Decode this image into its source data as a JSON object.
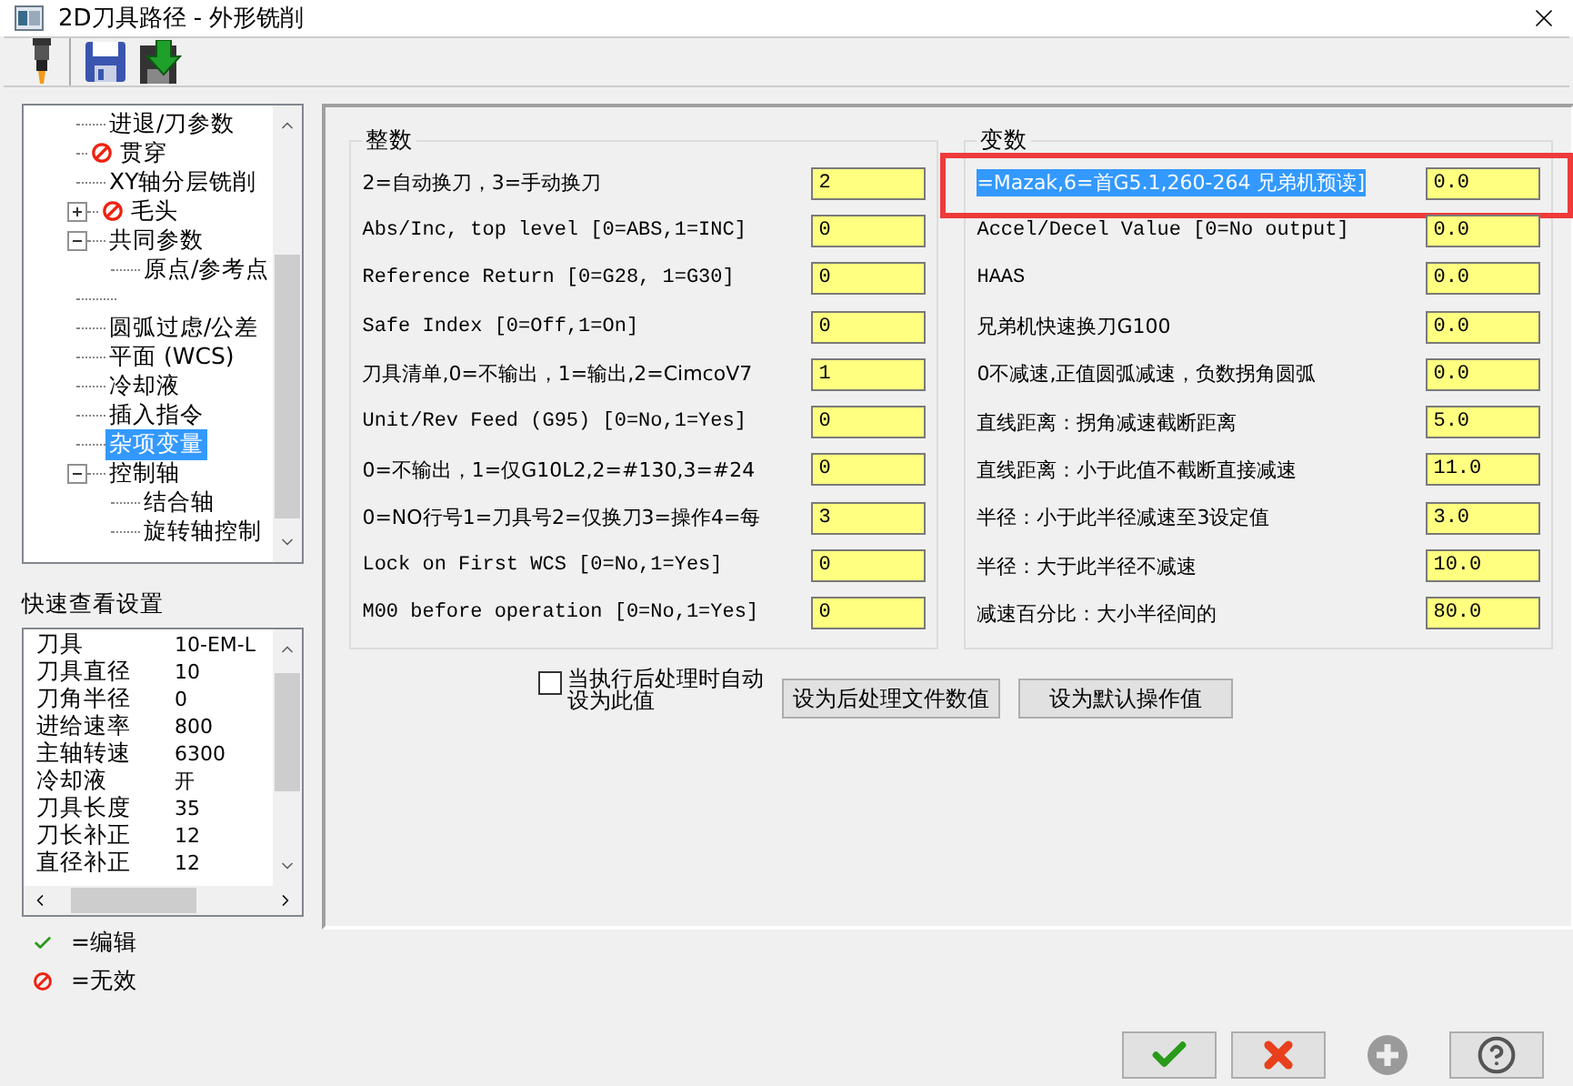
{
  "window": {
    "title": "2D刀具路径 - 外形铣削"
  },
  "tree": [
    {
      "children": [
        {
          "label": "进退/刀参数",
          "selected": false,
          "disabled": false
        },
        {
          "label": "贯穿",
          "selected": false,
          "disabled": true
        },
        {
          "label": "XY轴分层铣削",
          "selected": false,
          "disabled": false
        },
        {
          "label": "毛头",
          "selected": false,
          "disabled": true,
          "expanded": false
        }
      ]
    },
    {
      "label": "共同参数",
      "selected": false,
      "disabled": false,
      "expanded": true,
      "children": [
        {
          "label": "原点/参考点",
          "selected": false,
          "disabled": false
        }
      ]
    },
    {
      "kind": "blank"
    },
    {
      "label": "圆弧过虑/公差",
      "selected": false,
      "disabled": false
    },
    {
      "label": "平面 (WCS)",
      "selected": false,
      "disabled": false
    },
    {
      "label": "冷却液",
      "selected": false,
      "disabled": false
    },
    {
      "label": "插入指令",
      "selected": false,
      "disabled": false
    },
    {
      "label": "杂项变量",
      "selected": true,
      "disabled": false
    },
    {
      "label": "控制轴",
      "selected": false,
      "disabled": false,
      "expanded": true,
      "children": [
        {
          "label": "结合轴",
          "selected": false,
          "disabled": false
        },
        {
          "label": "旋转轴控制",
          "selected": false,
          "disabled": false
        }
      ]
    }
  ],
  "quick_view": {
    "title": "快速查看设置",
    "rows": [
      {
        "name": "刀具",
        "value": "10-EM-L"
      },
      {
        "name": "刀具直径",
        "value": "10"
      },
      {
        "name": "刀角半径",
        "value": "0"
      },
      {
        "name": "进给速率",
        "value": "800"
      },
      {
        "name": "主轴转速",
        "value": "6300"
      },
      {
        "name": "冷却液",
        "value": "开"
      },
      {
        "name": "刀具长度",
        "value": "35"
      },
      {
        "name": "刀长补正",
        "value": "12"
      },
      {
        "name": "直径补正",
        "value": "12"
      }
    ]
  },
  "legend": [
    {
      "kind": "edit",
      "text": "=编辑"
    },
    {
      "kind": "disabled",
      "text": "=无效"
    }
  ],
  "integers": {
    "title": "整数",
    "rows": [
      {
        "label": "2=自动换刀，3=手动换刀",
        "value": "2"
      },
      {
        "label": "Abs/Inc, top level [0=ABS,1=INC]",
        "value": "0"
      },
      {
        "label": "Reference Return [0=G28, 1=G30]",
        "value": "0"
      },
      {
        "label": "Safe Index [0=Off,1=On]",
        "value": "0"
      },
      {
        "label": "刀具清单,0=不输出，1=输出,2=CimcoV7",
        "value": "1"
      },
      {
        "label": "Unit/Rev Feed (G95) [0=No,1=Yes]",
        "value": "0"
      },
      {
        "label": "0=不输出，1=仅G10L2,2=#130,3=#24",
        "value": "0"
      },
      {
        "label": "0=NO行号1=刀具号2=仅换刀3=操作4=每",
        "value": "3"
      },
      {
        "label": "Lock on First WCS [0=No,1=Yes]",
        "value": "0"
      },
      {
        "label": "M00 before operation [0=No,1=Yes]",
        "value": "0"
      }
    ]
  },
  "variables": {
    "title": "变数",
    "rows": [
      {
        "label": "=Mazak,6=首G5.1,260-264 兄弟机预读]",
        "value": "0.0",
        "highlighted": true
      },
      {
        "label": "Accel/Decel Value [0=No output]",
        "value": "0.0",
        "highlighted": false
      },
      {
        "label": "HAAS",
        "value": "0.0",
        "highlighted": false
      },
      {
        "label": "兄弟机快速换刀G100",
        "value": "0.0",
        "highlighted": false
      },
      {
        "label": "0不减速,正值圆弧减速，负数拐角圆弧",
        "value": "0.0",
        "highlighted": false
      },
      {
        "label": "直线距离：拐角减速截断距离",
        "value": "5.0",
        "highlighted": false
      },
      {
        "label": "直线距离：小于此值不截断直接减速",
        "value": "11.0",
        "highlighted": false
      },
      {
        "label": "半径：小于此半径减速至3设定值",
        "value": "3.0",
        "highlighted": false
      },
      {
        "label": "半径：大于此半径不减速",
        "value": "10.0",
        "highlighted": false
      },
      {
        "label": "减速百分比：大小半径间的",
        "value": "80.0",
        "highlighted": false
      }
    ]
  },
  "auto_set": {
    "lines": [
      "当执行后处理时自动",
      "设为此值"
    ],
    "checked": false
  },
  "actions": [
    "设为后处理文件数值",
    "设为默认操作值"
  ],
  "dialog_buttons": [
    {
      "kind": "ok",
      "disabled": false
    },
    {
      "kind": "cancel",
      "disabled": false
    },
    {
      "kind": "add",
      "disabled": true
    },
    {
      "kind": "help",
      "disabled": false
    }
  ]
}
